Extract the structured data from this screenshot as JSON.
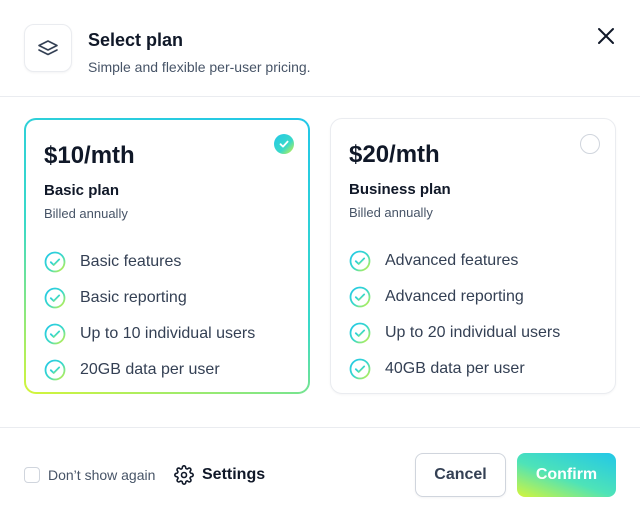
{
  "header": {
    "icon": "layers-icon",
    "title": "Select plan",
    "subtitle": "Simple and flexible per-user pricing.",
    "close_icon": "close-icon"
  },
  "plans": [
    {
      "price": "$10/mth",
      "name": "Basic plan",
      "billing": "Billed annually",
      "selected": true,
      "features": [
        "Basic features",
        "Basic reporting",
        "Up to 10 individual users",
        "20GB data per user"
      ]
    },
    {
      "price": "$20/mth",
      "name": "Business plan",
      "billing": "Billed annually",
      "selected": false,
      "features": [
        "Advanced features",
        "Advanced reporting",
        "Up to 20 individual users",
        "40GB data per user"
      ]
    }
  ],
  "footer": {
    "dont_show_again": "Don’t show again",
    "dont_show_again_checked": false,
    "settings_label": "Settings",
    "settings_icon": "gear-icon",
    "cancel_label": "Cancel",
    "confirm_label": "Confirm"
  },
  "colors": {
    "accent_cyan": "#22c7e8",
    "accent_teal": "#3ad9c8",
    "accent_lime": "#d5f53a",
    "text_primary": "#101828",
    "text_secondary": "#475467",
    "border": "#eaecf0"
  }
}
